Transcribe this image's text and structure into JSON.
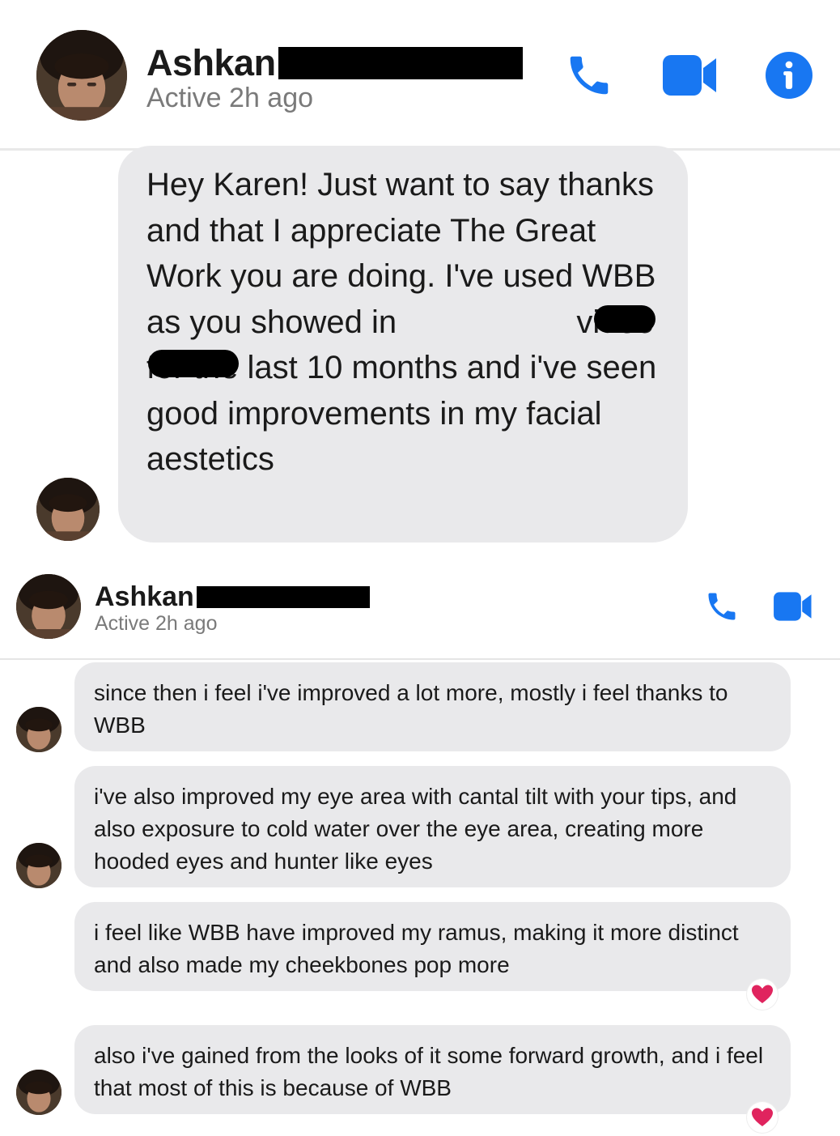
{
  "top_header": {
    "name": "Ashkan",
    "status": "Active 2h ago",
    "icons": [
      "phone-icon",
      "video-camera-icon",
      "info-icon"
    ]
  },
  "first_message": {
    "text": "Hey Karen! Just want to say thanks and that I appreciate The Great Work you are doing. I've used WBB as you showed in                    video for the last 10 months and i've seen good improvements in my facial aestetics"
  },
  "second_header": {
    "name": "Ashkan",
    "status": "Active 2h ago",
    "icons": [
      "phone-icon",
      "video-camera-icon"
    ]
  },
  "messages": [
    {
      "text": "since then i feel i've improved a lot more, mostly i feel thanks to WBB",
      "reaction": ""
    },
    {
      "text": "i've also improved my eye area with cantal tilt with your tips, and also exposure to cold water over the eye area, creating more hooded eyes and hunter like eyes",
      "reaction": ""
    },
    {
      "text": "i feel like WBB have improved my ramus, making it more distinct and also made my cheekbones pop more",
      "reaction": "heart-icon"
    },
    {
      "text": "also i've gained from the looks of it some forward growth, and i feel that most of this is because of WBB",
      "reaction": "heart-icon"
    }
  ],
  "colors": {
    "accent": "#1877f2",
    "bubble": "#e9e9eb",
    "status_gray": "#7a7a7a",
    "heart": "#e0245e"
  }
}
